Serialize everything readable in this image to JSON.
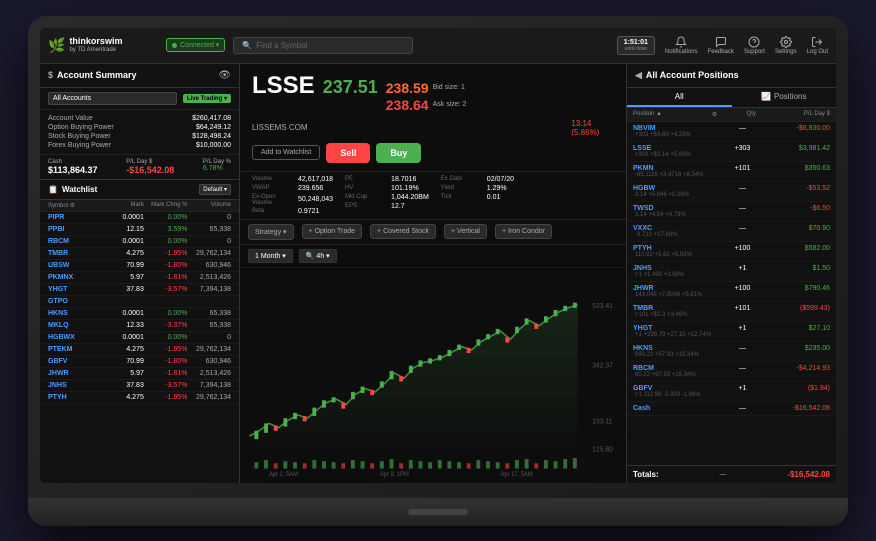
{
  "app": {
    "name": "thinkorswim",
    "sub": "by TD Ameritrade",
    "connected": "Connected ▾",
    "search_placeholder": "Find a Symbol",
    "time": "1:51:01",
    "time_label": "until close",
    "nav_items": [
      {
        "label": "Notifications",
        "icon": "bell"
      },
      {
        "label": "Feedback",
        "icon": "comment"
      },
      {
        "label": "Support",
        "icon": "question"
      },
      {
        "label": "Settings",
        "icon": "gear"
      },
      {
        "label": "Log Out",
        "icon": "exit"
      }
    ]
  },
  "account": {
    "title": "Account Summary",
    "all_accounts": "All Accounts",
    "live_trading": "Live Trading ▾",
    "rows": [
      {
        "label": "Account Value",
        "value": "$260,417.08"
      },
      {
        "label": "Option Buying Power",
        "value": "$64,249.12"
      },
      {
        "label": "Stock Buying Power",
        "value": "$128,498.24"
      },
      {
        "label": "Forex Buying Power",
        "value": "$10,000.00"
      }
    ],
    "cash_label": "Cash",
    "cash_value": "$113,864.37",
    "pnl_label": "P/L Day $",
    "pnl_value": "-$16,542.08",
    "pnl_pct_label": "P/L Day %",
    "pnl_pct_value": "6.78%"
  },
  "watchlist": {
    "title": "Watchlist",
    "default": "Default ▾",
    "columns": [
      "Symbol ⚙",
      "Mark",
      "Mark Chng %",
      "Volume"
    ],
    "rows": [
      {
        "symbol": "PIPR",
        "mark": "0.0001",
        "chng": "0.00%",
        "vol": "0",
        "chng_pos": true
      },
      {
        "symbol": "PPBI",
        "mark": "12.15",
        "chng": "3.59%",
        "vol": "65,338",
        "chng_pos": true
      },
      {
        "symbol": "RBCM",
        "mark": "0.0001",
        "chng": "0.00%",
        "vol": "0",
        "chng_pos": true
      },
      {
        "symbol": "TMBR",
        "mark": "4.275",
        "chng": "-1.95%",
        "vol": "29,762,134",
        "chng_pos": false
      },
      {
        "symbol": "UBSW",
        "mark": "70.99",
        "chng": "-1.80%",
        "vol": "630,946",
        "chng_pos": false
      },
      {
        "symbol": "PKMNX",
        "mark": "5.97",
        "chng": "-1.81%",
        "vol": "2,513,426",
        "chng_pos": false
      },
      {
        "symbol": "YHGT",
        "mark": "37.83",
        "chng": "-3.57%",
        "vol": "7,394,138",
        "chng_pos": false
      },
      {
        "symbol": "GTPO",
        "mark": "",
        "chng": "",
        "vol": "",
        "chng_pos": true
      },
      {
        "symbol": "HKNS",
        "mark": "0.0001",
        "chng": "0.00%",
        "vol": "65,338",
        "chng_pos": true
      },
      {
        "symbol": "MKLQ",
        "mark": "12.33",
        "chng": "-3.37%",
        "vol": "65,338",
        "chng_pos": false
      },
      {
        "symbol": "HGBWX",
        "mark": "0.0001",
        "chng": "0.00%",
        "vol": "0",
        "chng_pos": true
      },
      {
        "symbol": "PTEKM",
        "mark": "4.275",
        "chng": "-1.95%",
        "vol": "29,762,134",
        "chng_pos": false
      },
      {
        "symbol": "GBFV",
        "mark": "70.99",
        "chng": "-1.80%",
        "vol": "630,946",
        "chng_pos": false
      },
      {
        "symbol": "JHWR",
        "mark": "5.97",
        "chng": "-1.81%",
        "vol": "2,513,426",
        "chng_pos": false
      },
      {
        "symbol": "JNHS",
        "mark": "37.83",
        "chng": "-3.57%",
        "vol": "7,394,138",
        "chng_pos": false
      },
      {
        "symbol": "PTYH",
        "mark": "4.275",
        "chng": "-1.95%",
        "vol": "29,762,134",
        "chng_pos": false
      }
    ]
  },
  "symbol": {
    "ticker": "LSSE",
    "name": "LISSEMS COM",
    "last_price": "237.51",
    "bid": "238.59",
    "ask": "238.64",
    "change": "13.14 (5.86%)",
    "bid_size": "1",
    "ask_size": "2",
    "add_watchlist": "Add to Watchlist",
    "sell": "Sell",
    "buy": "Buy",
    "quote": [
      {
        "label": "Volume",
        "value": "42,617,018"
      },
      {
        "label": "VWAP",
        "value": "239.656"
      },
      {
        "label": "Ex-Open Volume",
        "value": "50,248,043"
      },
      {
        "label": "Beta",
        "value": "0.9721"
      },
      {
        "label": "PE",
        "value": "18.7016"
      },
      {
        "label": "HV",
        "value": "101.19%"
      },
      {
        "label": "Mkt Cap",
        "value": "1,044.20BM"
      },
      {
        "label": "EPS",
        "value": "12.7"
      },
      {
        "label": "Ex Date",
        "value": "02/07/20"
      },
      {
        "label": "Yield",
        "value": "1.29%"
      },
      {
        "label": "Tick",
        "value": "0.01"
      }
    ]
  },
  "chart": {
    "period": "1 Month ▾",
    "zoom": "🔍 4h ▾",
    "dates": [
      "Apr 2, 5AM",
      "Apr 9, 1PM",
      "Apr 17, 5AM"
    ],
    "price_high": "533.41",
    "price_mid": "342.37",
    "price_low": "133.11",
    "price_low2": "125.80"
  },
  "strategies": [
    {
      "label": "Strategy ▾"
    },
    {
      "label": "+ Option Trade"
    },
    {
      "label": "+ Covered Stock"
    },
    {
      "label": "+ Vertical"
    },
    {
      "label": "+ Iron Condor"
    }
  ],
  "positions": {
    "title": "All Account Positions",
    "tabs": [
      "All",
      "Positions"
    ],
    "active_tab": 0,
    "columns": [
      "Position ▲",
      "⚙",
      "Qty",
      "P/L Day $"
    ],
    "rows": [
      {
        "symbol": "NBVIM",
        "sub": "+303 +$4.60 +4.33%",
        "qty": "—",
        "pnl": "-$6,830.00",
        "pnl_pos": false
      },
      {
        "symbol": "LSSE",
        "sub": "+303 +$3.14 +5.86%",
        "qty": "+303",
        "pnl": "$3,981.42",
        "pnl_pos": true
      },
      {
        "symbol": "PKMN",
        "sub": "-65.1116 +3.4716 +8.34%",
        "qty": "+101",
        "pnl": "$350.63",
        "pnl_pos": true
      },
      {
        "symbol": "HGBW",
        "sub": "3.14 +5.846 +0.28%",
        "qty": "—",
        "pnl": "-$53.52",
        "pnl_pos": false
      },
      {
        "symbol": "TWSD",
        "sub": "3.14 +4.54 +4.73%",
        "qty": "—",
        "pnl": "-$6.50",
        "pnl_pos": false
      },
      {
        "symbol": "VXXC",
        "sub": "-3.710 +17.68%",
        "qty": "—",
        "pnl": "$70.90",
        "pnl_pos": true
      },
      {
        "symbol": "PTYH",
        "sub": "110.92 +5.82 +5.93%",
        "qty": "+100",
        "pnl": "$582.00",
        "pnl_pos": true
      },
      {
        "symbol": "JNHS",
        "sub": "+1 +1.490 +3.99%",
        "qty": "+1",
        "pnl": "$1.50",
        "pnl_pos": true
      },
      {
        "symbol": "JHWR",
        "sub": "143.046 +7.9046 +5.81%",
        "qty": "+100",
        "pnl": "$790.46",
        "pnl_pos": true
      },
      {
        "symbol": "TMBR",
        "sub": "+101 +$2.3 +3.46%",
        "qty": "+101",
        "pnl": "($599.43)",
        "pnl_pos": false
      },
      {
        "symbol": "YHGT",
        "sub": "+1 +239.79 +27.10 +12.74%",
        "qty": "+1",
        "pnl": "$27.10",
        "pnl_pos": true
      },
      {
        "symbol": "HKNS",
        "sub": "690.22 +57.93 +15.34%",
        "qty": "—",
        "pnl": "$235.00",
        "pnl_pos": true
      },
      {
        "symbol": "RBCM",
        "sub": "60.22 +57.93 +15.34%",
        "qty": "—",
        "pnl": "-$4,214.93",
        "pnl_pos": false
      },
      {
        "symbol": "GBFV",
        "sub": "+1 112.98 -3.938 -1.66%",
        "qty": "+1",
        "pnl": "($1.94)",
        "pnl_pos": false
      },
      {
        "symbol": "Cash",
        "sub": "",
        "qty": "—",
        "pnl": "-$16,542.08",
        "pnl_pos": false
      }
    ],
    "totals_label": "Totals:",
    "totals_qty": "—",
    "totals_pnl": "-$16,542.08"
  }
}
